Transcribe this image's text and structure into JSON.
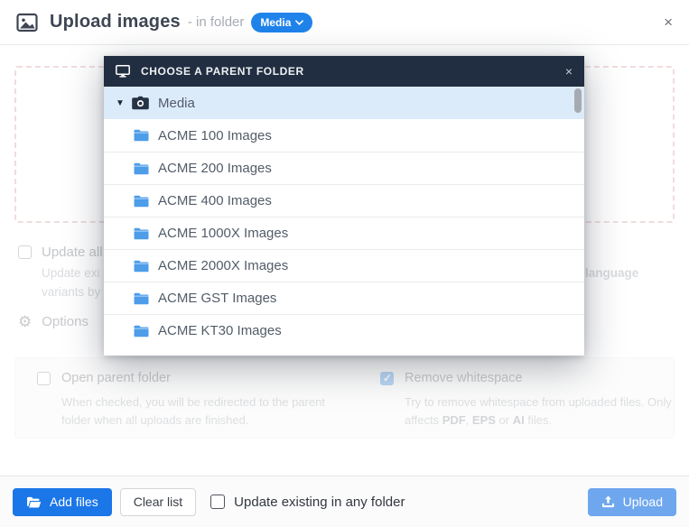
{
  "header": {
    "title": "Upload images",
    "subtitle": "- in folder",
    "folder_badge": "Media",
    "close": "×"
  },
  "dialog": {
    "update_all_label": "Update all",
    "update_all_desc_frag1": "Update exi",
    "update_all_desc_frag_right": "language",
    "update_all_desc_frag2": "variants by",
    "options_label": "Options",
    "options": [
      {
        "label": "Open parent folder",
        "checked": false,
        "desc": "When checked, you will be redirected to the parent folder when all uploads are finished."
      },
      {
        "label": "Remove whitespace",
        "checked": true,
        "desc_parts": [
          "Try to remove whitespace from uploaded files. Only affects ",
          "PDF",
          ", ",
          "EPS",
          " or ",
          "AI",
          " files."
        ]
      }
    ]
  },
  "modal": {
    "title": "CHOOSE A PARENT FOLDER",
    "close": "×",
    "root_folder": {
      "label": "Media",
      "selected": true
    },
    "subfolders": [
      "ACME 100 Images",
      "ACME 200 Images",
      "ACME 400 Images",
      "ACME 1000X Images",
      "ACME 2000X Images",
      "ACME GST Images",
      "ACME KT30 Images"
    ]
  },
  "footer": {
    "add_files": "Add files",
    "clear_list": "Clear list",
    "update_existing_label": "Update existing in any folder",
    "upload": "Upload"
  },
  "colors": {
    "accent": "#1b76e8",
    "modal_header_bg": "#212d40",
    "selected_row_bg": "#dcebfa",
    "folder_icon": "#4d9de9",
    "upload_disabled": "#6fa7ef",
    "badge_bg": "#1f83ea"
  }
}
